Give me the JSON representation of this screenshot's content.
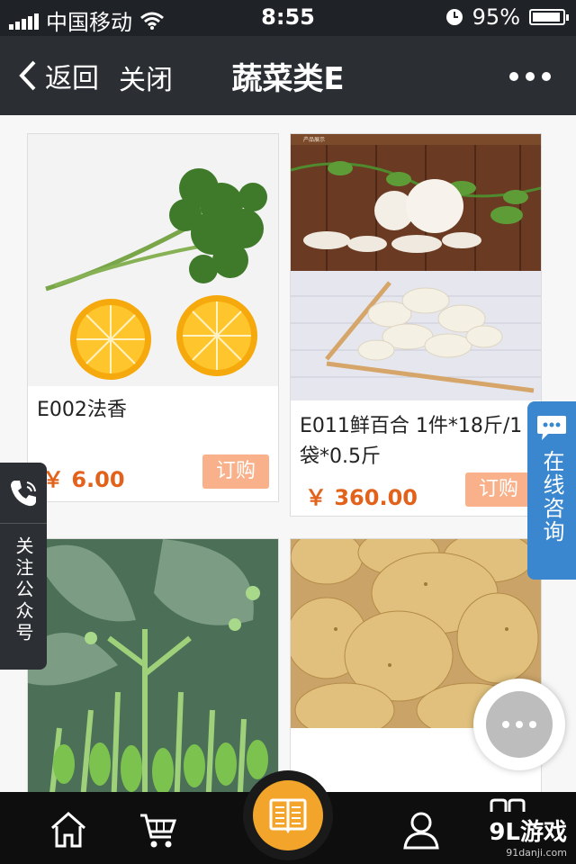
{
  "status_bar": {
    "carrier": "中国移动",
    "time": "8:55",
    "battery": "95%",
    "battery_level": 0.95
  },
  "nav": {
    "back_label": "返回",
    "close_label": "关闭",
    "title": "蔬菜类E"
  },
  "products": [
    {
      "name": "E002法香",
      "price": "￥ 6.00",
      "order_label": "订购"
    },
    {
      "name": "E011鲜百合 1件*18斤/1袋*0.5斤",
      "price": "￥ 360.00",
      "order_label": "订购",
      "banner_text": "产品展示"
    }
  ],
  "side_left": {
    "label": "关注公众号"
  },
  "side_right": {
    "label": "在线咨询"
  },
  "watermark": {
    "logo": "9L游戏",
    "url": "91danji.com"
  },
  "colors": {
    "accent": "#f3a52b",
    "price": "#e2621b",
    "order_button": "#f8b18a",
    "consult": "#3a87cf"
  }
}
